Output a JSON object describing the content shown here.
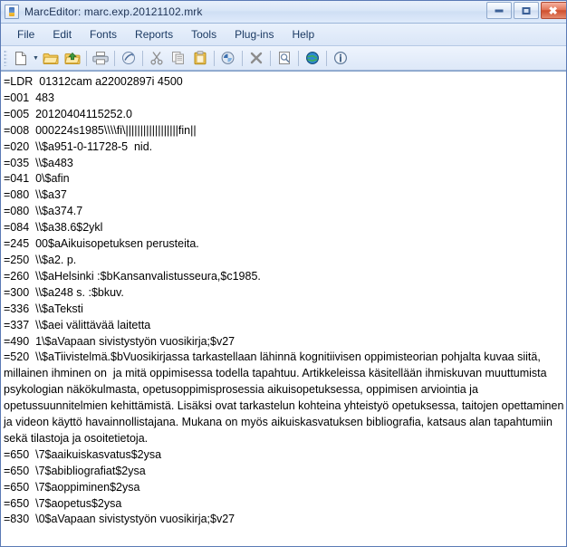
{
  "window": {
    "title": "MarcEditor: marc.exp.20121102.mrk",
    "app_icon": "marc-document-icon",
    "controls": {
      "minimize": "minimize-icon",
      "maximize": "maximize-icon",
      "close": "close-icon",
      "close_glyph": "✖"
    }
  },
  "menubar": {
    "items": [
      {
        "label": "File"
      },
      {
        "label": "Edit"
      },
      {
        "label": "Fonts"
      },
      {
        "label": "Reports"
      },
      {
        "label": "Tools"
      },
      {
        "label": "Plug-ins"
      },
      {
        "label": "Help"
      }
    ]
  },
  "toolbar": {
    "items": [
      {
        "name": "new-file-icon",
        "kind": "icon"
      },
      {
        "name": "new-file-dropdown-arrow-icon",
        "kind": "arrow",
        "glyph": "▼"
      },
      {
        "name": "open-folder-icon",
        "kind": "icon"
      },
      {
        "name": "save-folder-icon",
        "kind": "icon"
      },
      {
        "name": "separator-1",
        "kind": "sep"
      },
      {
        "name": "print-icon",
        "kind": "icon"
      },
      {
        "name": "separator-2",
        "kind": "sep"
      },
      {
        "name": "compile-marc-icon",
        "kind": "icon"
      },
      {
        "name": "separator-3",
        "kind": "sep"
      },
      {
        "name": "cut-icon",
        "kind": "icon"
      },
      {
        "name": "copy-icon",
        "kind": "icon"
      },
      {
        "name": "paste-icon",
        "kind": "icon"
      },
      {
        "name": "separator-4",
        "kind": "sep"
      },
      {
        "name": "find-replace-icon",
        "kind": "icon"
      },
      {
        "name": "separator-5",
        "kind": "sep"
      },
      {
        "name": "delete-icon",
        "kind": "icon"
      },
      {
        "name": "separator-6",
        "kind": "sep"
      },
      {
        "name": "preview-icon",
        "kind": "icon"
      },
      {
        "name": "separator-7",
        "kind": "sep"
      },
      {
        "name": "globe-icon",
        "kind": "icon"
      },
      {
        "name": "separator-8",
        "kind": "sep"
      },
      {
        "name": "info-icon",
        "kind": "icon"
      }
    ]
  },
  "editor": {
    "content": "=LDR  01312cam a22002897i 4500\n=001  483\n=005  20120404115252.0\n=008  000224s1985\\\\\\\\fi\\||||||||||||||||||fin||\n=020  \\\\$a951-0-11728-5  nid.\n=035  \\\\$a483\n=041  0\\$afin\n=080  \\\\$a37\n=080  \\\\$a374.7\n=084  \\\\$a38.6$2ykl\n=245  00$aAikuisopetuksen perusteita.\n=250  \\\\$a2. p.\n=260  \\\\$aHelsinki :$bKansanvalistusseura,$c1985.\n=300  \\\\$a248 s. :$bkuv.\n=336  \\\\$aTeksti\n=337  \\\\$aei välittävää laitetta\n=490  1\\$aVapaan sivistystyön vuosikirja;$v27\n=520  \\\\$aTiivistelmä.$bVuosikirjassa tarkastellaan lähinnä kognitiivisen oppimisteorian pohjalta kuvaa siitä, millainen ihminen on  ja mitä oppimisessa todella tapahtuu. Artikkeleissa käsitellään ihmiskuvan muuttumista psykologian näkökulmasta, opetusoppimisprosessia aikuisopetuksessa, oppimisen arviointia ja opetussuunnitelmien kehittämistä. Lisäksi ovat tarkastelun kohteina yhteistyö opetuksessa, taitojen opettaminen ja videon käyttö havainnollistajana. Mukana on myös aikuiskasvatuksen bibliografia, katsaus alan tapahtumiin sekä tilastoja ja osoitetietoja.\n=650  \\7$aaikuiskasvatus$2ysa\n=650  \\7$abibliografiat$2ysa\n=650  \\7$aoppiminen$2ysa\n=650  \\7$aopetus$2ysa\n=830  \\0$aVapaan sivistystyön vuosikirja;$v27"
  },
  "colors": {
    "title_bar": "#d9e6f7",
    "menu_bar": "#e0ebf9",
    "window_border": "#5a7ab5",
    "editor_background": "#ffffff",
    "text": "#000000",
    "close_button": "#cf4f2e"
  }
}
